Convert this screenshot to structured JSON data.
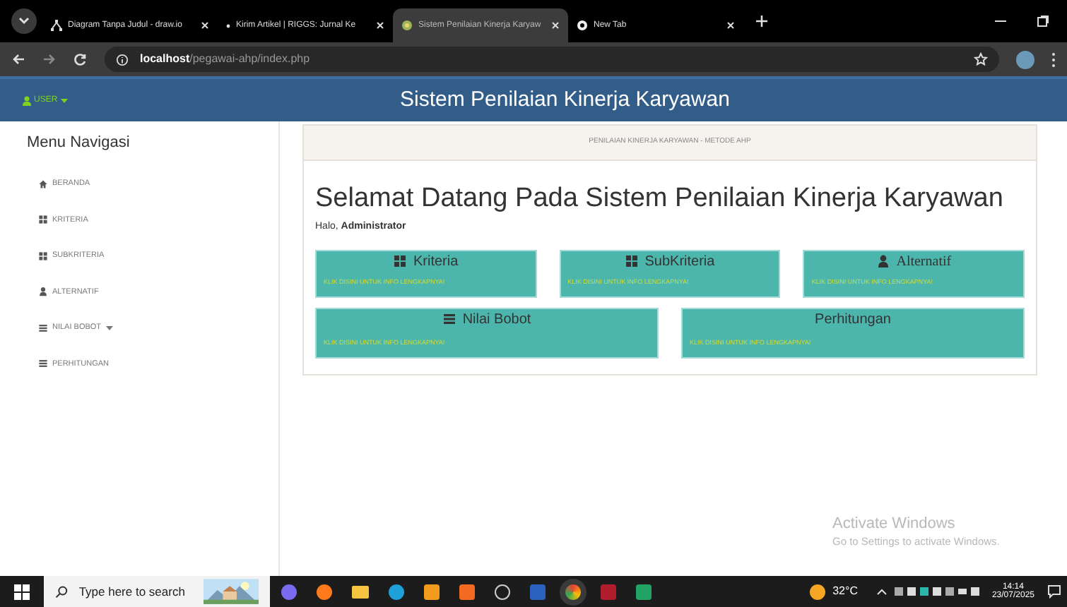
{
  "browser": {
    "tabs": [
      {
        "title": "Diagram Tanpa Judul - draw.io",
        "kind": "drawio",
        "selected": false
      },
      {
        "title": "Kirim Artikel | RIGGS: Jurnal Ke",
        "kind": "dot",
        "selected": false
      },
      {
        "title": "Sistem Penilaian Kinerja Karyaw",
        "kind": "site",
        "selected": true
      },
      {
        "title": "New Tab",
        "kind": "chrome",
        "selected": false
      }
    ],
    "address": {
      "host": "localhost",
      "path": "/pegawai-ahp/index.php"
    }
  },
  "header": {
    "user_menu": "USER",
    "title": "Sistem Penilaian Kinerja Karyawan"
  },
  "sidebar": {
    "title": "Menu Navigasi",
    "items": [
      {
        "label": "BERANDA",
        "kind": "home",
        "dropdown": false
      },
      {
        "label": "KRITERIA",
        "kind": "grid",
        "dropdown": false
      },
      {
        "label": "SUBKRITERIA",
        "kind": "grid",
        "dropdown": false
      },
      {
        "label": "ALTERNATIF",
        "kind": "user",
        "dropdown": false
      },
      {
        "label": "NILAI BOBOT",
        "kind": "list",
        "dropdown": true
      },
      {
        "label": "PERHITUNGAN",
        "kind": "list",
        "dropdown": false
      }
    ]
  },
  "main": {
    "breadcrumb": "PENILAIAN KINERJA KARYAWAN - METODE AHP",
    "heading": "Selamat Datang Pada Sistem Penilaian Kinerja Karyawan",
    "greeting": "Halo, **Administrator**",
    "cards": [
      {
        "title": "Kriteria",
        "kind": "grid",
        "link": "KLIK DISINI UNTUK INFO LENGKAPNYA!"
      },
      {
        "title": "SubKriteria",
        "kind": "grid",
        "link": "KLIK DISINI UNTUK INFO LENGKAPNYA!"
      },
      {
        "title": "Alternatif",
        "kind": "user",
        "link": "KLIK DISINI UNTUK INFO LENGKAPNYA!"
      },
      {
        "title": "Nilai Bobot",
        "kind": "list",
        "link": "KLIK DISINI UNTUK INFO LENGKAPNYA!"
      },
      {
        "title": "Perhitungan",
        "kind": "plain",
        "link": "KLIK DISINI UNTUK INFO LENGKAPNYA!"
      }
    ]
  },
  "watermark": {
    "title": "Activate Windows",
    "text": "Go to Settings to activate Windows."
  },
  "taskbar": {
    "search_placeholder": "Type here to search",
    "weather": "32°C",
    "time": "14:14",
    "date": "23/07/2025"
  }
}
